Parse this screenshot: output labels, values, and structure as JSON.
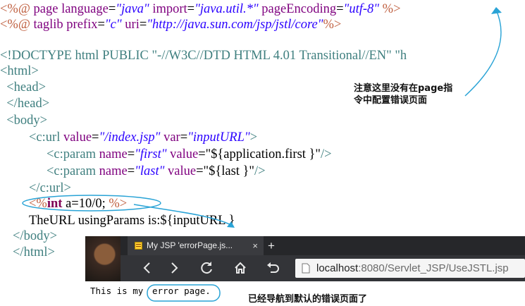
{
  "code": {
    "line1": {
      "open": "<%@",
      "kw": " page",
      "a1": " language",
      "v1": "\"java\"",
      "a2": " import",
      "v2": "\"java.util.*\"",
      "a3": " pageEncoding",
      "v3": "\"utf-8\"",
      "close": " %>"
    },
    "line2": {
      "open": "<%@",
      "kw": " taglib",
      "a1": " prefix",
      "v1": "\"c\"",
      "a2": " uri",
      "v2": "\"http://java.sun.com/jsp/jstl/core\"",
      "close": "%>"
    },
    "line4": "<!DOCTYPE html PUBLIC \"-//W3C//DTD HTML 4.01 Transitional//EN\" \"h",
    "line5": "<html>",
    "line6": "  <head>",
    "line7": "  </head>",
    "line8": "  <body>",
    "line9": {
      "tag": "<c:url",
      "a1": " value",
      "v1": "\"/index.jsp\"",
      "a2": " var",
      "v2": "\"inputURL\"",
      "close": ">"
    },
    "line10": {
      "tag": "<c:param",
      "a1": " name",
      "v1": "\"first\"",
      "a2": " value",
      "v2": "\"${application.first }\"",
      "close": "/>"
    },
    "line11": {
      "tag": "<c:param",
      "a1": " name",
      "v1": "\"last\"",
      "a2": " value",
      "v2": "\"${last }\"",
      "close": "/>"
    },
    "line12": "</c:url>",
    "line13": {
      "open": "<%",
      "kw": "int",
      "rest": " a=10/0; ",
      "close": "%>"
    },
    "line14": "TheURL usingParams is:${inputURL }",
    "line15": "</body>",
    "line16": "</html>"
  },
  "annotations": {
    "note1": "注意这里没有在page指\n令中配置错误页面",
    "note2": "已经导航到默认的错误页面了"
  },
  "browser": {
    "tab_title": "My JSP 'errorPage.js...",
    "tab_close": "×",
    "new_tab": "+",
    "url_host": "localhost",
    "url_path": ":8080/Servlet_JSP/UseJSTL.jsp"
  },
  "page_output": {
    "text_part1": "This is my",
    "text_part2": "error page."
  },
  "colors": {
    "tag": "#3f7f7f",
    "attr": "#7f007f",
    "string": "#2a00ff",
    "arrow": "#29a3d6"
  }
}
